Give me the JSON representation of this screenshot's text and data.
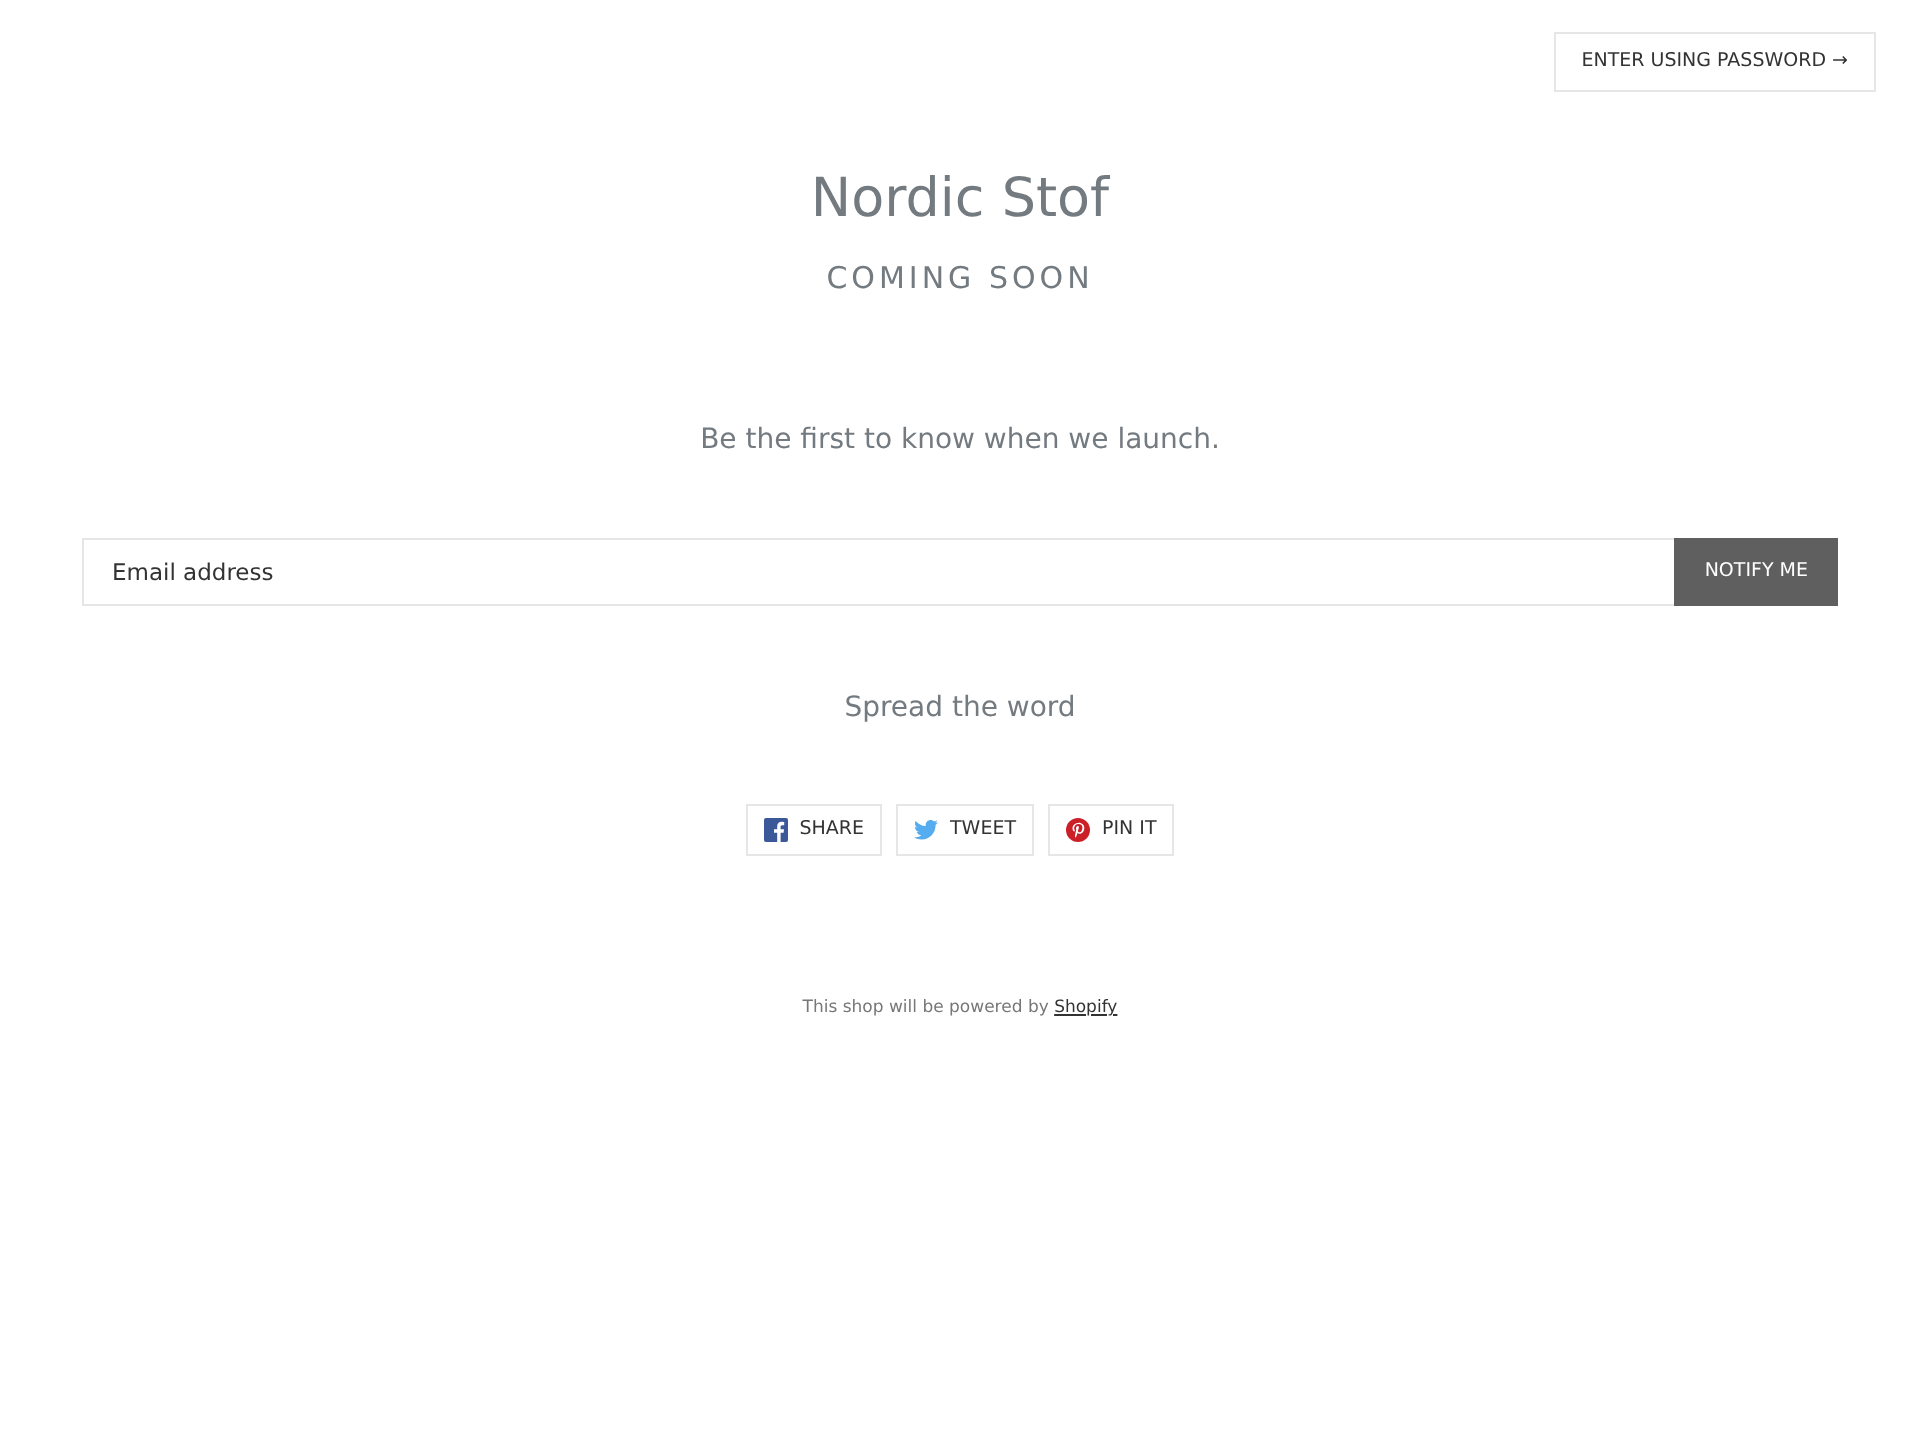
{
  "header": {
    "password_link": "ENTER USING PASSWORD →"
  },
  "shop_name": "Nordic Stof",
  "subtitle": "COMING SOON",
  "tagline": "Be the first to know when we launch.",
  "signup": {
    "placeholder": "Email address",
    "button": "NOTIFY ME"
  },
  "share": {
    "heading": "Spread the word",
    "buttons": [
      {
        "kind": "facebook",
        "label": "SHARE"
      },
      {
        "kind": "twitter",
        "label": "TWEET"
      },
      {
        "kind": "pinterest",
        "label": "PIN IT"
      }
    ]
  },
  "footer": {
    "text": "This shop will be powered by",
    "link": "Shopify"
  }
}
